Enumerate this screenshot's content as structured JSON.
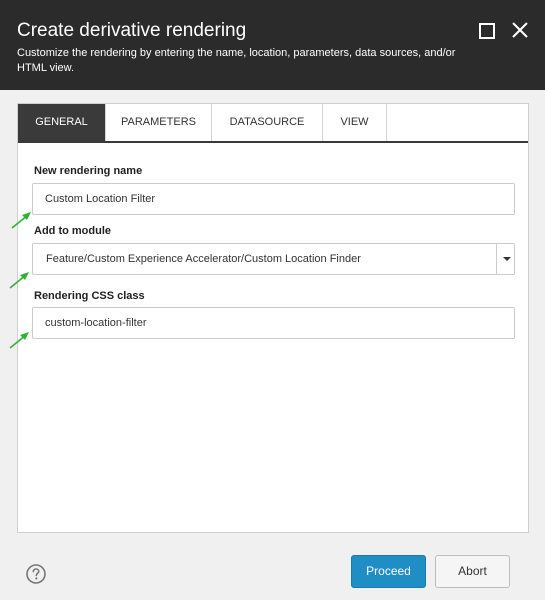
{
  "dialog": {
    "title": "Create derivative rendering",
    "subtitle": "Customize the rendering by entering the name, location, parameters, data sources, and/or HTML view."
  },
  "tabs": [
    {
      "label": "GENERAL",
      "active": true
    },
    {
      "label": "PARAMETERS",
      "active": false
    },
    {
      "label": "DATASOURCE",
      "active": false
    },
    {
      "label": "VIEW",
      "active": false
    }
  ],
  "form": {
    "rendering_name": {
      "label": "New rendering name",
      "value": "Custom Location Filter"
    },
    "module": {
      "label": "Add to module",
      "value": "Feature/Custom Experience Accelerator/Custom Location Finder"
    },
    "css_class": {
      "label": "Rendering CSS class",
      "value": "custom-location-filter"
    }
  },
  "footer": {
    "proceed_label": "Proceed",
    "abort_label": "Abort"
  },
  "colors": {
    "titlebar": "#2b2b2b",
    "active_tab": "#3a3a3a",
    "primary_button": "#1f8ec4",
    "annotation_arrow": "#2db52d"
  },
  "icons": {
    "maximize": "maximize-icon",
    "close": "close-icon",
    "help": "help-icon",
    "dropdown": "chevron-down-icon",
    "annotation": "arrow-icon"
  }
}
